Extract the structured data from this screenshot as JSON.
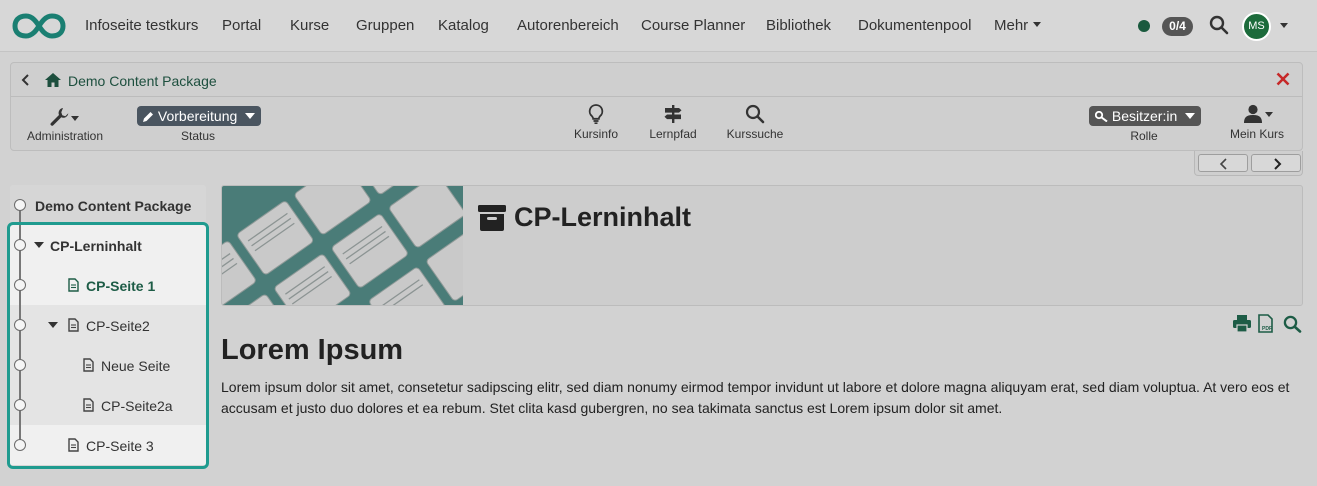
{
  "topnav": {
    "items": [
      "Infoseite testkurs",
      "Portal",
      "Kurse",
      "Gruppen",
      "Katalog",
      "Autorenbereich",
      "Course Planner",
      "Bibliothek",
      "Dokumentenpool",
      "Mehr"
    ],
    "counter": "0/4",
    "avatar_initials": "MS"
  },
  "course": {
    "title": "Demo Content Package",
    "tools": {
      "administration": "Administration",
      "status_value": "Vorbereitung",
      "status_label": "Status",
      "kursinfo": "Kursinfo",
      "lernpfad": "Lernpfad",
      "kurssuche": "Kurssuche",
      "role_value": "Besitzer:in",
      "role_label": "Rolle",
      "mein_kurs": "Mein Kurs"
    }
  },
  "tree": {
    "root": "Demo Content Package",
    "items": [
      {
        "label": "CP-Lerninhalt"
      },
      {
        "label": "CP-Seite 1"
      },
      {
        "label": "CP-Seite2"
      },
      {
        "label": "Neue Seite"
      },
      {
        "label": "CP-Seite2a"
      },
      {
        "label": "CP-Seite 3"
      }
    ]
  },
  "content": {
    "title": "CP-Lerninhalt",
    "heading": "Lorem Ipsum",
    "paragraph": "Lorem ipsum dolor sit amet, consetetur sadipscing elitr, sed diam nonumy eirmod tempor invidunt ut labore et dolore magna aliquyam erat, sed diam voluptua. At vero eos et accusam et justo duo dolores et ea rebum. Stet clita kasd gubergren, no sea takimata sanctus est Lorem ipsum dolor sit amet."
  },
  "colors": {
    "brand": "#1a7f72",
    "accent_dark_green": "#1d5c46",
    "focus_frame": "#1f9b8f",
    "close": "#c62828",
    "pill": "#4a5560"
  },
  "icons": [
    "infinity-logo-icon",
    "search-icon",
    "home-icon",
    "back-arrow-icon",
    "close-icon",
    "wrench-icon",
    "pencil-icon",
    "lightbulb-icon",
    "signpost-icon",
    "key-icon",
    "user-icon",
    "archive-icon",
    "document-icon",
    "print-icon",
    "pdf-icon",
    "chevron-left-icon",
    "chevron-right-icon"
  ]
}
